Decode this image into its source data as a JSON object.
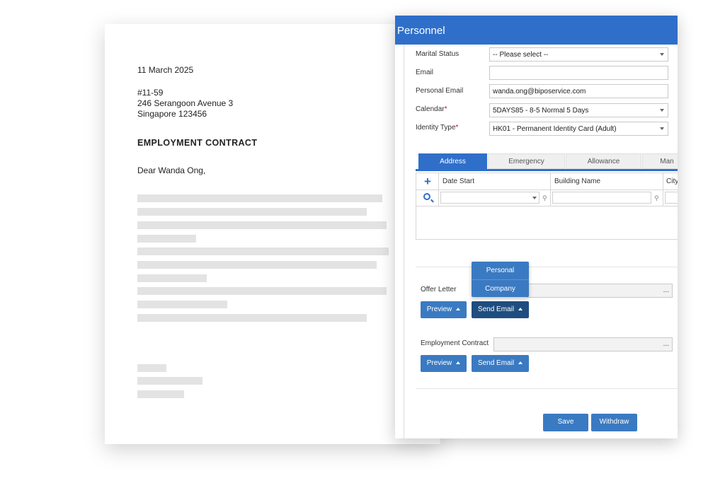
{
  "letter": {
    "date": "11 March 2025",
    "address": [
      "#11-59",
      "246 Serangoon Avenue 3",
      "Singapore 123456"
    ],
    "title": "EMPLOYMENT CONTRACT",
    "greeting": "Dear Wanda Ong,"
  },
  "window": {
    "title": "Personnel",
    "fields": {
      "marital_status": {
        "label": "Marital Status",
        "value": "-- Please select --"
      },
      "email": {
        "label": "Email",
        "value": ""
      },
      "personal_email": {
        "label": "Personal Email",
        "value": "wanda.ong@biposervice.com"
      },
      "calendar": {
        "label": "Calendar",
        "value": "5DAYS85 - 8-5 Normal 5 Days"
      },
      "identity_type": {
        "label": "Identity Type",
        "value": "HK01 - Permanent Identity Card (Adult)"
      }
    },
    "required_mark": "*",
    "tabs": [
      "Address",
      "Emergency",
      "Allowance",
      "Man"
    ],
    "grid": {
      "columns": [
        "Date Start",
        "Building Name",
        "City"
      ]
    },
    "offer_letter": {
      "label": "Offer Letter",
      "value": ""
    },
    "employment_contract": {
      "label": "Employment Contract",
      "value": ""
    },
    "browse": "...",
    "preview": "Preview",
    "send_email": "Send Email",
    "send_menu": [
      "Personal",
      "Company"
    ],
    "save": "Save",
    "withdraw": "Withdraw"
  },
  "colors": {
    "accent": "#2f6fc9",
    "button": "#3a7ac2",
    "button_active": "#1f4d80",
    "required": "#d0021b"
  }
}
